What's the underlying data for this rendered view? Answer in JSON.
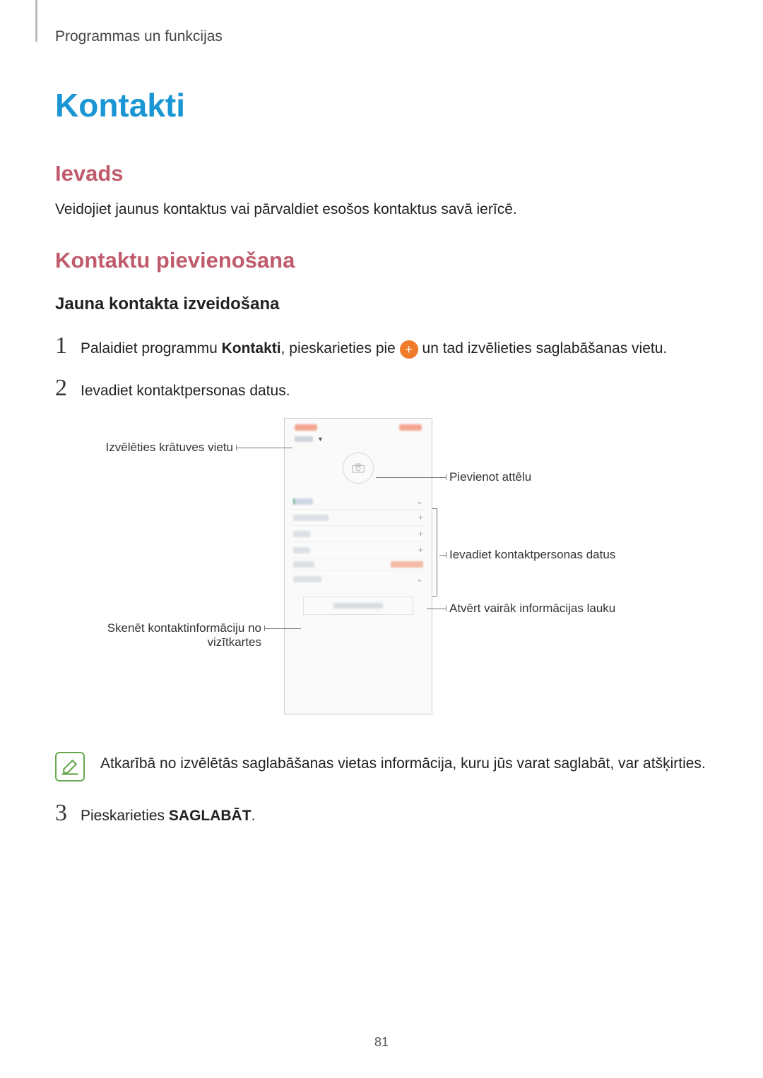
{
  "header": {
    "chapter": "Programmas un funkcijas"
  },
  "title": "Kontakti",
  "section_intro": {
    "heading": "Ievads",
    "text": "Veidojiet jaunus kontaktus vai pārvaldiet esošos kontaktus savā ierīcē."
  },
  "section_add": {
    "heading": "Kontaktu pievienošana",
    "subheading": "Jauna kontakta izveidošana"
  },
  "steps": {
    "s1": {
      "num": "1",
      "pre": "Palaidiet programmu ",
      "bold": "Kontakti",
      "mid": ", pieskarieties pie ",
      "post": " un tad izvēlieties saglabāšanas vietu."
    },
    "s2": {
      "num": "2",
      "text": "Ievadiet kontaktpersonas datus."
    },
    "s3": {
      "num": "3",
      "pre": "Pieskarieties ",
      "bold": "SAGLABĀT",
      "post": "."
    }
  },
  "callouts": {
    "storage": "Izvēlēties krātuves vietu",
    "add_image": "Pievienot attēlu",
    "enter_data": "Ievadiet kontaktpersonas datus",
    "open_more": "Atvērt vairāk informācijas lauku",
    "scan_card_l1": "Skenēt kontaktinformāciju no",
    "scan_card_l2": "vizītkartes"
  },
  "note": {
    "text": "Atkarībā no izvēlētās saglabāšanas vietas informācija, kuru jūs varat saglabāt, var atšķirties."
  },
  "icons": {
    "plus": "+",
    "camera": "camera",
    "chevron_down": "⌄"
  },
  "page_number": "81"
}
